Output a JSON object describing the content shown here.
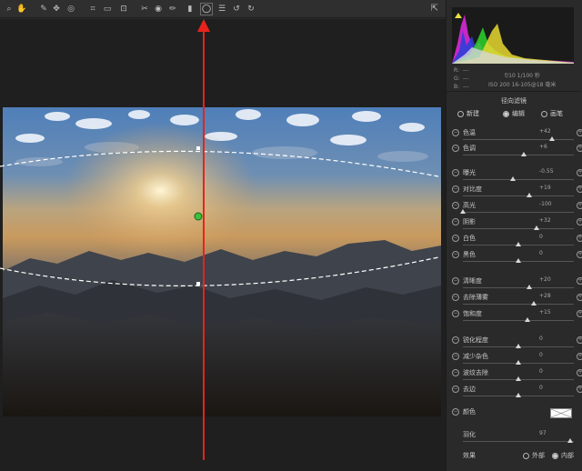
{
  "toolbar": {
    "tools": [
      {
        "name": "zoom-tool",
        "glyph": "⌕"
      },
      {
        "name": "hand-tool",
        "glyph": "✋"
      },
      {
        "name": "white-balance-tool",
        "glyph": "✎"
      },
      {
        "name": "color-sampler-tool",
        "glyph": "✥"
      },
      {
        "name": "targeted-adjustment-tool",
        "glyph": "◎"
      },
      {
        "name": "crop-tool",
        "glyph": "⌗"
      },
      {
        "name": "straighten-tool",
        "glyph": "▭"
      },
      {
        "name": "transform-tool",
        "glyph": "⊡"
      },
      {
        "name": "spot-removal-tool",
        "glyph": "✂"
      },
      {
        "name": "red-eye-tool",
        "glyph": "◉"
      },
      {
        "name": "adjustment-brush-tool",
        "glyph": "✏"
      },
      {
        "name": "graduated-filter-tool",
        "glyph": "▮"
      },
      {
        "name": "radial-filter-tool",
        "glyph": "◯"
      },
      {
        "name": "preferences-tool",
        "glyph": "☰"
      },
      {
        "name": "rotate-left-tool",
        "glyph": "↺"
      },
      {
        "name": "rotate-right-tool",
        "glyph": "↻"
      }
    ],
    "fullscreen_glyph": "⇱"
  },
  "readout": {
    "r_label": "R:",
    "g_label": "G:",
    "b_label": "B:",
    "r_value": "---",
    "g_value": "---",
    "b_value": "---",
    "exif_line1": "f/10  1/100 秒",
    "exif_line2": "ISO 200  16-105@18 毫米"
  },
  "panel": {
    "title": "径向滤镜",
    "modes": [
      "新建",
      "编辑",
      "画笔"
    ],
    "selected_mode": "编辑",
    "params": [
      {
        "label": "色温",
        "value": "+42",
        "level": 0.8
      },
      {
        "label": "色调",
        "value": "+6",
        "level": 0.55
      },
      {
        "label": "曝光",
        "value": "-0.55",
        "level": 0.45
      },
      {
        "label": "对比度",
        "value": "+19",
        "level": 0.6
      },
      {
        "label": "高光",
        "value": "-100",
        "level": 0.0
      },
      {
        "label": "阴影",
        "value": "+32",
        "level": 0.66
      },
      {
        "label": "白色",
        "value": "0",
        "level": 0.5
      },
      {
        "label": "黑色",
        "value": "0",
        "level": 0.5
      },
      {
        "label": "清晰度",
        "value": "+20",
        "level": 0.6
      },
      {
        "label": "去除薄雾",
        "value": "+28",
        "level": 0.64
      },
      {
        "label": "饱和度",
        "value": "+15",
        "level": 0.58
      },
      {
        "label": "锐化程度",
        "value": "0",
        "level": 0.5
      },
      {
        "label": "减少杂色",
        "value": "0",
        "level": 0.5
      },
      {
        "label": "波纹去除",
        "value": "0",
        "level": 0.5
      },
      {
        "label": "去边",
        "value": "0",
        "level": 0.5
      }
    ],
    "color_label": "颜色",
    "feather_label": "羽化",
    "feather_value": "97",
    "feather_level": 0.97,
    "effect_label": "效果",
    "effect_options": [
      "外部",
      "内部"
    ],
    "effect_selected": "内部"
  },
  "colors": {
    "annotation_arrow": "#e8231b",
    "mask_outline": "#ffffff",
    "pin_green": "#39c23a"
  }
}
